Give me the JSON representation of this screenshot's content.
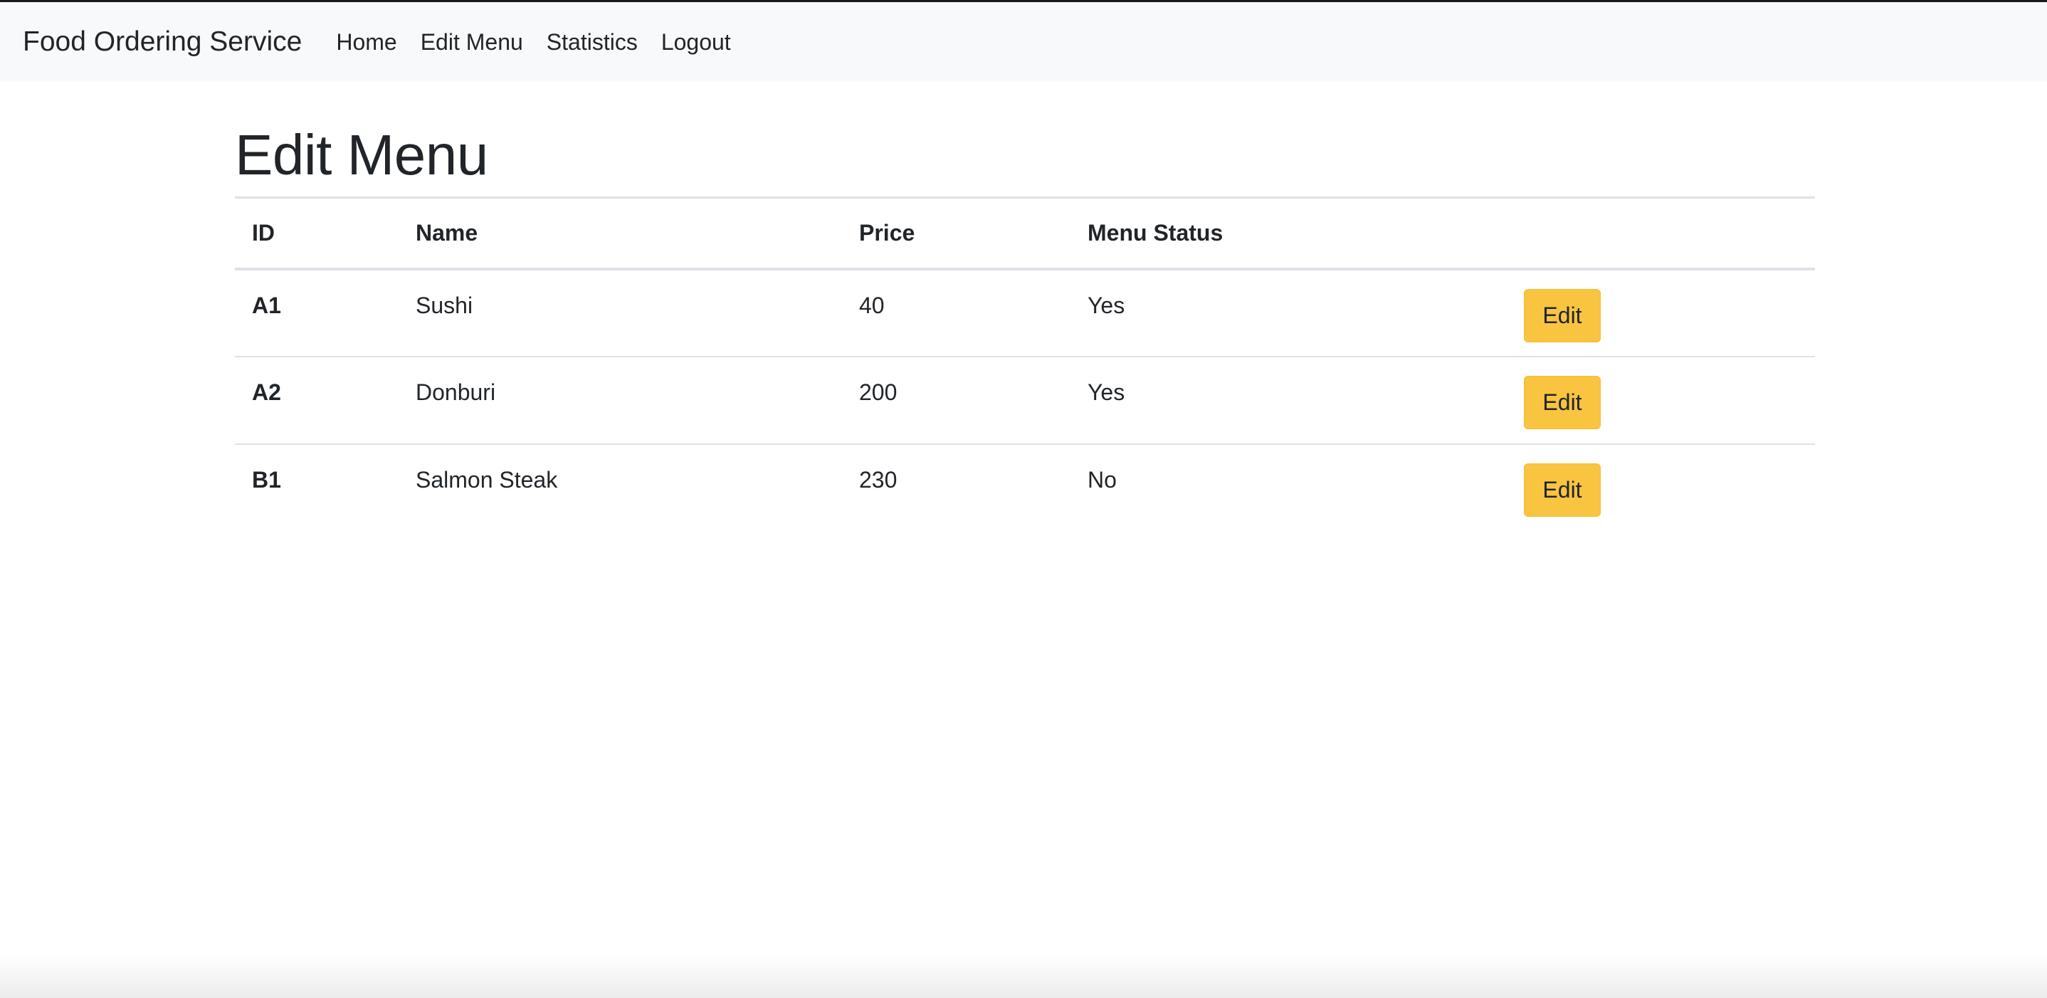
{
  "navbar": {
    "brand": "Food Ordering Service",
    "links": [
      {
        "label": "Home"
      },
      {
        "label": "Edit Menu"
      },
      {
        "label": "Statistics"
      },
      {
        "label": "Logout"
      }
    ]
  },
  "page": {
    "title": "Edit Menu"
  },
  "table": {
    "headers": [
      "ID",
      "Name",
      "Price",
      "Menu Status",
      ""
    ],
    "rows": [
      {
        "id": "A1",
        "name": "Sushi",
        "price": "40",
        "status": "Yes",
        "action": "Edit"
      },
      {
        "id": "A2",
        "name": "Donburi",
        "price": "200",
        "status": "Yes",
        "action": "Edit"
      },
      {
        "id": "B1",
        "name": "Salmon Steak",
        "price": "230",
        "status": "No",
        "action": "Edit"
      }
    ]
  },
  "colors": {
    "navbar_bg": "#f8f9fa",
    "edit_button": "#f9c440",
    "text": "#212529",
    "table_border": "#dee2e6"
  }
}
